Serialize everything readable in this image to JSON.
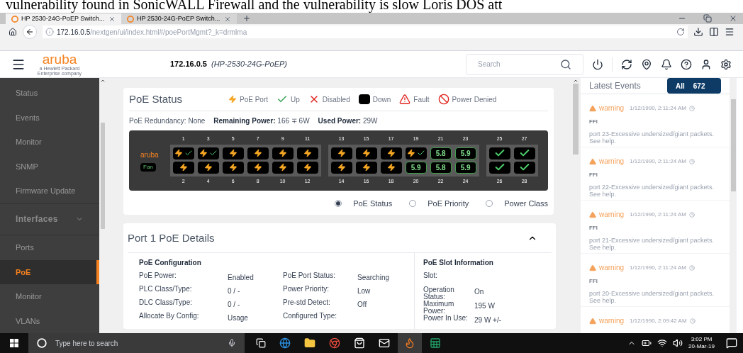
{
  "document_caption": "vulnerability found in SonicWALL Firewall and the vulnerability is slow Loris DOS att",
  "browser": {
    "tabs": [
      {
        "title": "HP 2530-24G-PoEP Switch...",
        "selected": true
      },
      {
        "title": "HP 2530-24G-PoEP Switch...",
        "selected": false
      }
    ],
    "url_host": "172.16.0.5",
    "url_path": "/nextgen/ui/index.html#/poePortMgmt?_k=drmlma"
  },
  "header": {
    "logo": "aruba",
    "logo_subtitle": "a Hewlett Packard Enterprise company",
    "hostname": "172.16.0.5",
    "model": "(HP-2530-24G-PoEP)",
    "search": {
      "placeholder": "Search"
    }
  },
  "sidebar": {
    "items": [
      {
        "label": "Status",
        "kind": "item",
        "selected": false
      },
      {
        "label": "Events",
        "kind": "item",
        "selected": false
      },
      {
        "label": "Monitor",
        "kind": "item",
        "selected": false
      },
      {
        "label": "SNMP",
        "kind": "item",
        "selected": false
      },
      {
        "label": "Firmware Update",
        "kind": "item",
        "selected": false
      },
      {
        "label": "Interfaces",
        "kind": "section",
        "expanded": true,
        "selected": false
      },
      {
        "label": "Ports",
        "kind": "item",
        "selected": false
      },
      {
        "label": "PoE",
        "kind": "item",
        "selected": true
      },
      {
        "label": "Monitor",
        "kind": "item",
        "selected": false
      },
      {
        "label": "VLANs",
        "kind": "item",
        "selected": false
      }
    ]
  },
  "poe_status": {
    "title": "PoE Status",
    "legend": [
      {
        "kind": "poe",
        "label": "PoE Port"
      },
      {
        "kind": "up",
        "label": "Up"
      },
      {
        "kind": "disabled",
        "label": "Disabled"
      },
      {
        "kind": "down",
        "label": "Down"
      },
      {
        "kind": "fault",
        "label": "Fault"
      },
      {
        "kind": "denied",
        "label": "Power Denied"
      }
    ],
    "summary": [
      {
        "label": "PoE Redundancy:",
        "value": "None",
        "bold": false
      },
      {
        "label": "Remaining Power:",
        "value": "166 ∓ 6W",
        "bold": true
      },
      {
        "label": "Used Power:",
        "value": "29W",
        "bold": true
      }
    ],
    "switch": {
      "logo": "aruba",
      "fan": "Fan",
      "groups": [
        {
          "columns": [
            {
              "top": {
                "number": "1",
                "kind": "poe_up"
              },
              "bottom": {
                "number": "2",
                "kind": "poe"
              }
            },
            {
              "top": {
                "number": "3",
                "kind": "poe_up"
              },
              "bottom": {
                "number": "4",
                "kind": "poe"
              }
            },
            {
              "top": {
                "number": "5",
                "kind": "poe"
              },
              "bottom": {
                "number": "6",
                "kind": "poe"
              }
            },
            {
              "top": {
                "number": "7",
                "kind": "poe"
              },
              "bottom": {
                "number": "8",
                "kind": "poe"
              }
            },
            {
              "top": {
                "number": "9",
                "kind": "poe"
              },
              "bottom": {
                "number": "10",
                "kind": "poe"
              }
            },
            {
              "top": {
                "number": "11",
                "kind": "poe"
              },
              "bottom": {
                "number": "12",
                "kind": "poe"
              }
            }
          ]
        },
        {
          "columns": [
            {
              "top": {
                "number": "13",
                "kind": "poe"
              },
              "bottom": {
                "number": "14",
                "kind": "poe"
              }
            },
            {
              "top": {
                "number": "15",
                "kind": "poe"
              },
              "bottom": {
                "number": "16",
                "kind": "poe"
              }
            },
            {
              "top": {
                "number": "17",
                "kind": "poe"
              },
              "bottom": {
                "number": "18",
                "kind": "poe"
              }
            },
            {
              "top": {
                "number": "19",
                "kind": "poe_up"
              },
              "bottom": {
                "number": "20",
                "kind": "power",
                "value": "5.9"
              }
            },
            {
              "top": {
                "number": "21",
                "kind": "power",
                "value": "5.8"
              },
              "bottom": {
                "number": "22",
                "kind": "power",
                "value": "5.8"
              }
            },
            {
              "top": {
                "number": "23",
                "kind": "power",
                "value": "5.9"
              },
              "bottom": {
                "number": "24",
                "kind": "power",
                "value": "5.9"
              }
            }
          ]
        },
        {
          "columns": [
            {
              "top": {
                "number": "25",
                "kind": "up"
              },
              "bottom": {
                "number": "26",
                "kind": "up"
              }
            },
            {
              "top": {
                "number": "27",
                "kind": "up"
              },
              "bottom": {
                "number": "28",
                "kind": "up"
              }
            }
          ]
        }
      ]
    },
    "view_options": [
      {
        "label": "PoE Status",
        "selected": true
      },
      {
        "label": "PoE Priority",
        "selected": false
      },
      {
        "label": "Power Class",
        "selected": false
      }
    ]
  },
  "details": {
    "title": "Port 1 PoE Details",
    "expanded": true,
    "configuration": {
      "title": "PoE Configuration",
      "rows": [
        [
          {
            "label": "PoE Power:",
            "value": "Enabled"
          },
          {
            "label": "PoE Port Status:",
            "value": "Searching"
          }
        ],
        [
          {
            "label": "PLC Class/Type:",
            "value": "0 / -"
          },
          {
            "label": "Power Priority:",
            "value": "Low"
          }
        ],
        [
          {
            "label": "DLC Class/Type:",
            "value": "0 / -"
          },
          {
            "label": "Pre-std Detect:",
            "value": "Off"
          }
        ],
        [
          {
            "label": "Allocate By Config:",
            "value": "Usage"
          },
          {
            "label": "Configured Type:"
          }
        ]
      ]
    },
    "slot": {
      "title": "PoE Slot Information",
      "rows": [
        {
          "label": "Slot:"
        },
        {
          "label": "Operation Status:",
          "value": "On"
        },
        {
          "label": "Maximum Power:",
          "value": "195 W"
        },
        {
          "label": "Power In Use:",
          "value": "29 W +/-"
        }
      ]
    }
  },
  "events": {
    "title": "Latest Events",
    "filter": "All",
    "count": "672",
    "items": [
      {
        "severity": "warning",
        "time": "1/12/1990, 2:11:24 AM",
        "source": "FFI",
        "message": "port 23-Excessive undersized/giant packets. See help."
      },
      {
        "severity": "warning",
        "time": "1/12/1990, 2:11:24 AM",
        "source": "FFI",
        "message": "port 22-Excessive undersized/giant packets. See help."
      },
      {
        "severity": "warning",
        "time": "1/12/1990, 2:11:24 AM",
        "source": "FFI",
        "message": "port 21-Excessive undersized/giant packets. See help."
      },
      {
        "severity": "warning",
        "time": "1/12/1990, 2:11:24 AM",
        "source": "FFI",
        "message": "port 20-Excessive undersized/giant packets. See help."
      },
      {
        "severity": "warning",
        "time": "1/12/1990, 2:09:42 AM"
      }
    ]
  },
  "taskbar": {
    "search_placeholder": "Type here to search",
    "time": "3:02 PM",
    "date": "20-Mar-19"
  }
}
